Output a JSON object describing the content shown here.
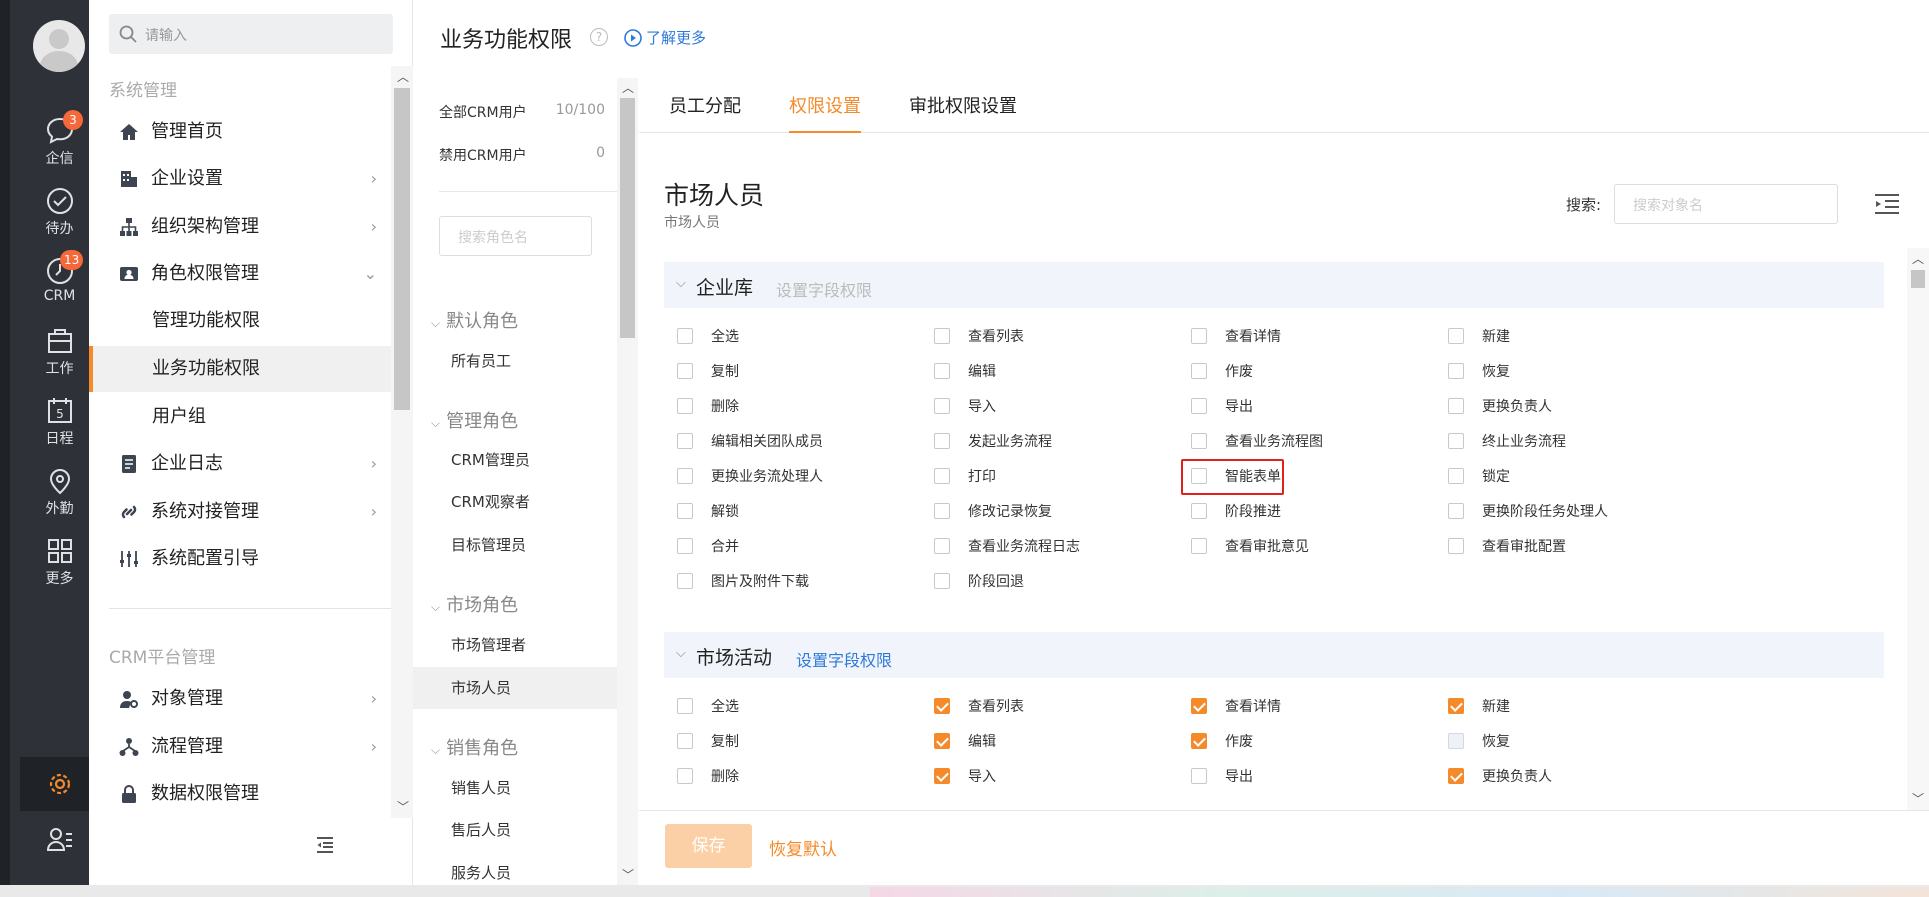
{
  "rail": {
    "items": [
      {
        "label": "企信",
        "icon": "chat-icon",
        "badge": "3"
      },
      {
        "label": "待办",
        "icon": "check-circle-icon",
        "badge": ""
      },
      {
        "label": "CRM",
        "icon": "clock-icon",
        "badge": "13"
      },
      {
        "label": "工作",
        "icon": "briefcase-icon",
        "badge": ""
      },
      {
        "label": "日程",
        "icon": "calendar-icon",
        "badge": ""
      },
      {
        "label": "外勤",
        "icon": "location-pin-icon",
        "badge": ""
      },
      {
        "label": "更多",
        "icon": "grid-icon",
        "badge": ""
      }
    ],
    "calendar_day": "5"
  },
  "nav": {
    "search_placeholder": "请输入",
    "section1": "系统管理",
    "items": [
      {
        "label": "管理首页",
        "icon": "home-icon"
      },
      {
        "label": "企业设置",
        "icon": "building-icon"
      },
      {
        "label": "组织架构管理",
        "icon": "org-chart-icon"
      },
      {
        "label": "角色权限管理",
        "icon": "id-card-icon"
      }
    ],
    "sub_items": [
      "管理功能权限",
      "业务功能权限",
      "用户组"
    ],
    "items2": [
      {
        "label": "企业日志",
        "icon": "document-icon"
      },
      {
        "label": "系统对接管理",
        "icon": "link-icon"
      },
      {
        "label": "系统配置引导",
        "icon": "sliders-icon"
      }
    ],
    "section2": "CRM平台管理",
    "items3": [
      {
        "label": "对象管理",
        "icon": "user-gear-icon"
      },
      {
        "label": "流程管理",
        "icon": "flow-icon"
      },
      {
        "label": "数据权限管理",
        "icon": "lock-icon"
      }
    ]
  },
  "header": {
    "title": "业务功能权限",
    "help": "?",
    "learn_more": "了解更多"
  },
  "roles": {
    "all_users_label": "全部CRM用户",
    "all_users_count": "10/100",
    "disabled_users_label": "禁用CRM用户",
    "disabled_users_count": "0",
    "search_placeholder": "搜索角色名",
    "groups": [
      {
        "name": "默认角色",
        "roles": [
          "所有员工"
        ]
      },
      {
        "name": "管理角色",
        "roles": [
          "CRM管理员",
          "CRM观察者",
          "目标管理员"
        ]
      },
      {
        "name": "市场角色",
        "roles": [
          "市场管理者",
          "市场人员"
        ]
      },
      {
        "name": "销售角色",
        "roles": [
          "销售人员",
          "售后人员",
          "服务人员"
        ]
      }
    ]
  },
  "tabs": [
    "员工分配",
    "权限设置",
    "审批权限设置"
  ],
  "active_tab": "权限设置",
  "role_title": "市场人员",
  "role_subtitle": "市场人员",
  "search": {
    "label": "搜索:",
    "placeholder": "搜索对象名"
  },
  "sections": [
    {
      "name": "企业库",
      "field_link": "设置字段权限",
      "perms": [
        [
          "全选",
          "查看列表",
          "查看详情",
          "新建"
        ],
        [
          "复制",
          "编辑",
          "作废",
          "恢复"
        ],
        [
          "删除",
          "导入",
          "导出",
          "更换负责人"
        ],
        [
          "编辑相关团队成员",
          "发起业务流程",
          "查看业务流程图",
          "终止业务流程"
        ],
        [
          "更换业务流处理人",
          "打印",
          "智能表单",
          "锁定"
        ],
        [
          "解锁",
          "修改记录恢复",
          "阶段推进",
          "更换阶段任务处理人"
        ],
        [
          "合并",
          "查看业务流程日志",
          "查看审批意见",
          "查看审批配置"
        ],
        [
          "图片及附件下载",
          "阶段回退"
        ]
      ],
      "checked": []
    },
    {
      "name": "市场活动",
      "field_link": "设置字段权限",
      "perms": [
        [
          "全选",
          "查看列表",
          "查看详情",
          "新建"
        ],
        [
          "复制",
          "编辑",
          "作废",
          "恢复"
        ],
        [
          "删除",
          "导入",
          "导出",
          "更换负责人"
        ]
      ],
      "checked": [
        "查看列表",
        "查看详情",
        "新建",
        "编辑",
        "作废",
        "导入",
        "更换负责人"
      ]
    }
  ],
  "footer": {
    "save": "保存",
    "reset": "恢复默认"
  },
  "colors": {
    "accent": "#f58a2b",
    "link": "#2f7ad9",
    "rail_bg": "#2e3238",
    "highlight": "#e0201b"
  }
}
